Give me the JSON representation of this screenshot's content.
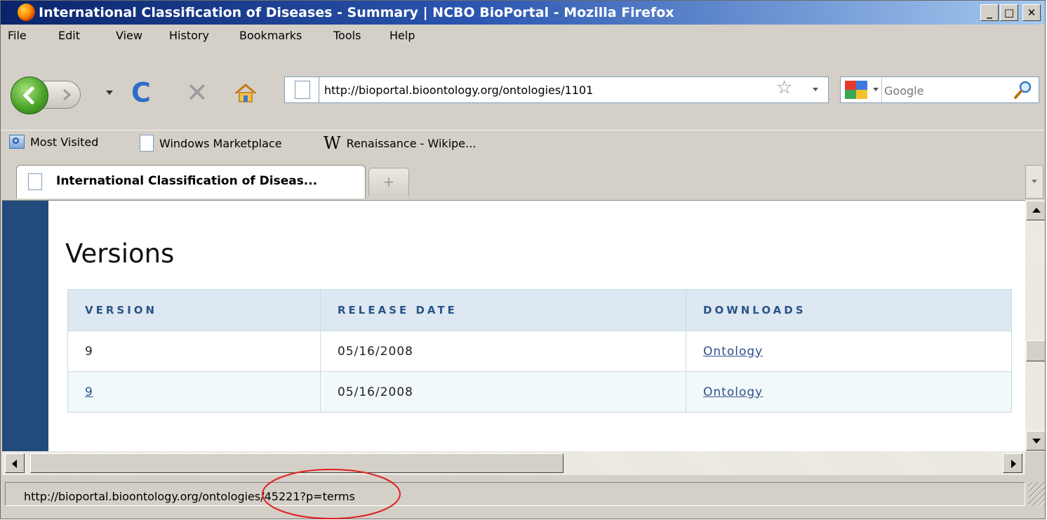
{
  "window": {
    "title": "International Classification of Diseases - Summary | NCBO BioPortal - Mozilla Firefox",
    "minimize_glyph": "_",
    "maximize_glyph": "□",
    "close_glyph": "✕"
  },
  "menu": [
    "File",
    "Edit",
    "View",
    "History",
    "Bookmarks",
    "Tools",
    "Help"
  ],
  "navbar": {
    "url": "http://bioportal.bioontology.org/ontologies/1101",
    "search_placeholder": "Google",
    "reload_glyph": "C",
    "stop_glyph": "✕",
    "star_glyph": "☆"
  },
  "bookmarks": [
    {
      "label": "Most Visited",
      "icon": "folder-icon"
    },
    {
      "label": "Windows Marketplace",
      "icon": "page-icon"
    },
    {
      "label": "Renaissance - Wikipe...",
      "icon": "wikipedia-icon",
      "icon_glyph": "W"
    }
  ],
  "tabs": {
    "active_label": "International Classification of Diseas...",
    "new_tab_glyph": "+"
  },
  "page": {
    "heading": "Versions",
    "table": {
      "headers": [
        "VERSION",
        "RELEASE DATE",
        "DOWNLOADS"
      ],
      "rows": [
        {
          "version": "9",
          "release_date": "05/16/2008",
          "download": "Ontology"
        },
        {
          "version": "9",
          "release_date": "05/16/2008",
          "download": "Ontology"
        }
      ]
    }
  },
  "status": {
    "text": "http://bioportal.bioontology.org/ontologies/45221?p=terms"
  },
  "colors": {
    "sidebar_accent": "#224a7a",
    "header_text": "#2a5486",
    "link": "#2f4f8b",
    "annotation": "#e02020"
  }
}
